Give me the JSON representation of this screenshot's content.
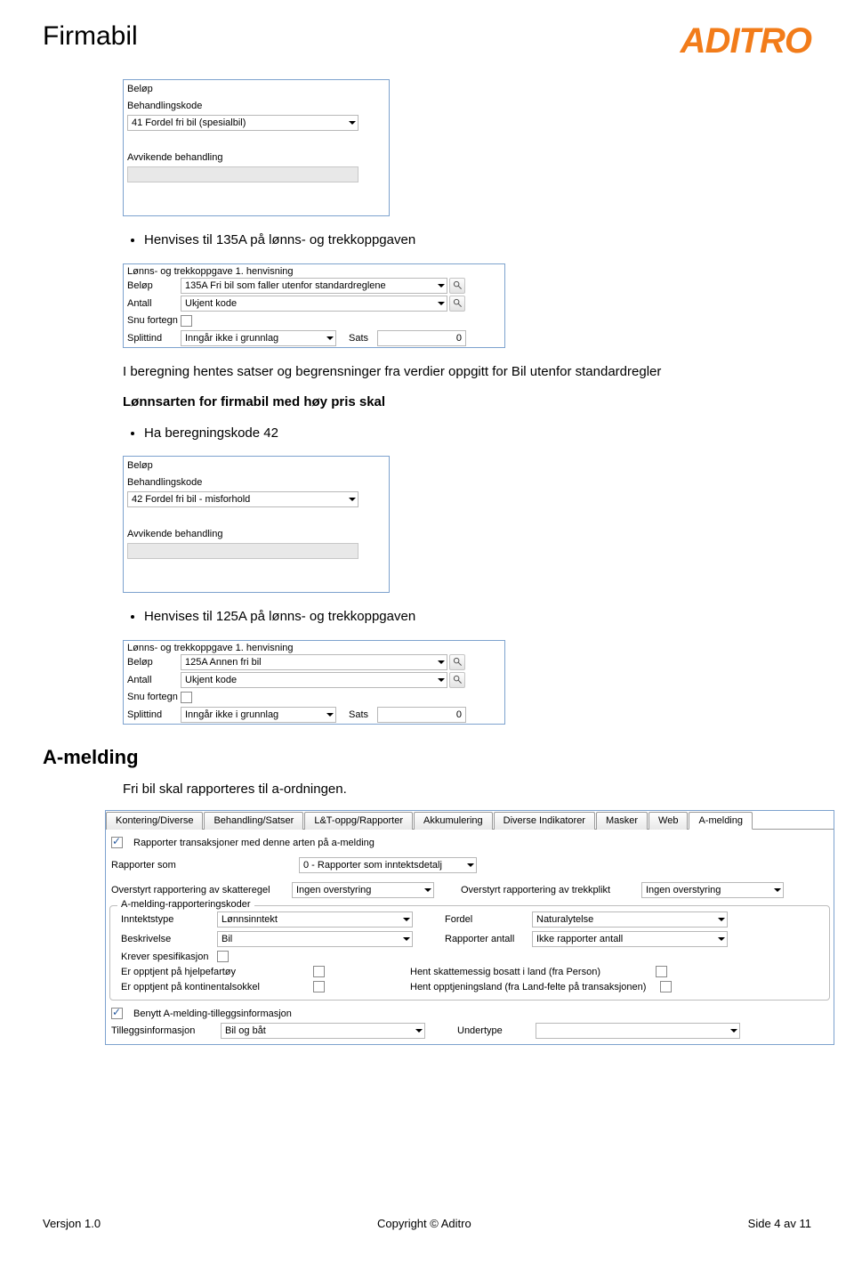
{
  "header": {
    "title": "Firmabil",
    "logo": "ADITRO"
  },
  "panel1": {
    "rows": {
      "r1": "Beløp",
      "r2": "Behandlingskode",
      "combo1": "41 Fordel fri bil (spesialbil)",
      "r3": "Avvikende behandling"
    }
  },
  "bullets1": [
    "Henvises til 135A på lønns- og trekkoppgaven"
  ],
  "panel2": {
    "title": "Lønns- og trekkoppgave 1. henvisning",
    "rows": {
      "belop": "Beløp",
      "belop_val": "135A Fri bil som faller utenfor standardreglene",
      "antall": "Antall",
      "antall_val": "Ukjent kode",
      "snu": "Snu fortegn",
      "splitt": "Splittind",
      "splitt_val": "Inngår ikke i grunnlag",
      "sats": "Sats",
      "sats_val": "0"
    }
  },
  "paragraph1": "I beregning hentes satser og begrensninger fra verdier oppgitt for Bil utenfor standardregler",
  "bold_line": "Lønnsarten for firmabil med høy pris skal",
  "bullets2": [
    "Ha beregningskode 42"
  ],
  "panel3": {
    "rows": {
      "r1": "Beløp",
      "r2": "Behandlingskode",
      "combo1": "42 Fordel fri bil - misforhold",
      "r3": "Avvikende behandling"
    }
  },
  "bullets3": [
    "Henvises til 125A på lønns- og trekkoppgaven"
  ],
  "panel4": {
    "title": "Lønns- og trekkoppgave 1. henvisning",
    "rows": {
      "belop": "Beløp",
      "belop_val": "125A Annen fri bil",
      "antall": "Antall",
      "antall_val": "Ukjent kode",
      "snu": "Snu fortegn",
      "splitt": "Splittind",
      "splitt_val": "Inngår ikke i grunnlag",
      "sats": "Sats",
      "sats_val": "0"
    }
  },
  "h2_amelding": "A-melding",
  "paragraph2": "Fri bil skal rapporteres til a-ordningen.",
  "amelding": {
    "tabs": [
      "Kontering/Diverse",
      "Behandling/Satser",
      "L&T-oppg/Rapporter",
      "Akkumulering",
      "Diverse Indikatorer",
      "Masker",
      "Web",
      "A-melding"
    ],
    "chk1": "Rapporter transaksjoner med denne arten på a-melding",
    "rapporter_som_lbl": "Rapporter som",
    "rapporter_som_val": "0 - Rapporter som inntektsdetalj",
    "ov_skatt_lbl": "Overstyrt rapportering av skatteregel",
    "ov_skatt_val": "Ingen overstyring",
    "ov_trekk_lbl": "Overstyrt rapportering av trekkplikt",
    "ov_trekk_val": "Ingen overstyring",
    "fieldset_legend": "A-melding-rapporteringskoder",
    "inntektstype_lbl": "Inntektstype",
    "inntektstype_val": "Lønnsinntekt",
    "fordel_lbl": "Fordel",
    "fordel_val": "Naturalytelse",
    "beskrivelse_lbl": "Beskrivelse",
    "beskrivelse_val": "Bil",
    "rapporter_antall_lbl": "Rapporter antall",
    "rapporter_antall_val": "Ikke rapporter antall",
    "krever_spes": "Krever spesifikasjon",
    "opptjent_hjelp": "Er opptjent på hjelpefartøy",
    "opptjent_kont": "Er opptjent på kontinentalsokkel",
    "hent_skatt": "Hent skattemessig bosatt i land (fra Person)",
    "hent_oppt": "Hent opptjeningsland (fra Land-felte på transaksjonen)",
    "benytt": "Benytt A-melding-tilleggsinformasjon",
    "tillegg_lbl": "Tilleggsinformasjon",
    "tillegg_val": "Bil og båt",
    "undertype_lbl": "Undertype"
  },
  "footer": {
    "left": "Versjon 1.0",
    "center": "Copyright © Aditro",
    "right": "Side 4 av 11"
  }
}
